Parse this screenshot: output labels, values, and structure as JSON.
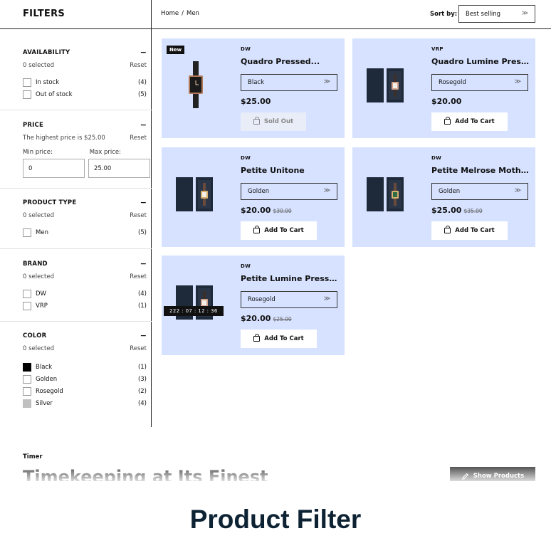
{
  "sidebar": {
    "title": "FILTERS",
    "availability": {
      "title": "AVAILABILITY",
      "selected": "0 selected",
      "reset": "Reset",
      "options": [
        {
          "label": "In stock",
          "count": "(4)"
        },
        {
          "label": "Out of stock",
          "count": "(5)"
        }
      ]
    },
    "price": {
      "title": "PRICE",
      "highest": "The highest price is $25.00",
      "reset": "Reset",
      "min_label": "Min price:",
      "max_label": "Max price:",
      "min_value": "0",
      "max_value": "25.00"
    },
    "product_type": {
      "title": "PRODUCT TYPE",
      "selected": "0 selected",
      "reset": "Reset",
      "options": [
        {
          "label": "Men",
          "count": "(5)"
        }
      ]
    },
    "brand": {
      "title": "BRAND",
      "selected": "0 selected",
      "reset": "Reset",
      "options": [
        {
          "label": "DW",
          "count": "(4)"
        },
        {
          "label": "VRP",
          "count": "(1)"
        }
      ]
    },
    "color": {
      "title": "COLOR",
      "selected": "0 selected",
      "reset": "Reset",
      "options": [
        {
          "label": "Black",
          "count": "(1)",
          "swatch": "#000000"
        },
        {
          "label": "Golden",
          "count": "(3)",
          "swatch": "#ffffff"
        },
        {
          "label": "Rosegold",
          "count": "(2)",
          "swatch": "#ffffff"
        },
        {
          "label": "Silver",
          "count": "(4)",
          "swatch": "#c0c0c0"
        }
      ]
    },
    "minus_symbol": "−"
  },
  "topbar": {
    "breadcrumb": [
      "Home",
      "/",
      "Men"
    ],
    "sort_label": "Sort by:",
    "sort_value": "Best selling",
    "chevron": "≫"
  },
  "products": [
    {
      "badge": "New",
      "brand": "DW",
      "name": "Quadro Pressed...",
      "variant": "Black",
      "price": "$25.00",
      "old_price": "",
      "button": "Sold Out"
    },
    {
      "brand": "VRP",
      "name": "Quadro Lumine Presse...",
      "variant": "Rosegold",
      "price": "$20.00",
      "old_price": "",
      "button": "Add To Cart"
    },
    {
      "brand": "DW",
      "name": "Petite Unitone",
      "variant": "Golden",
      "price": "$20.00",
      "old_price": "$30.00",
      "button": "Add To Cart"
    },
    {
      "brand": "DW",
      "name": "Petite Melrose Mother ...",
      "variant": "Golden",
      "price": "$25.00",
      "old_price": "$35.00",
      "button": "Add To Cart"
    },
    {
      "brand": "DW",
      "name": "Petite Lumine Pressed...",
      "variant": "Rosegold",
      "price": "$20.00",
      "old_price": "$25.00",
      "button": "Add To Cart",
      "timer": "222 : 07 : 12 : 36"
    }
  ],
  "section": {
    "label": "Timer",
    "headline": "Timekeeping at Its Finest",
    "button": "Show Products"
  },
  "caption": "Product Filter",
  "colors": {
    "card_bg": "#d6e2ff",
    "caption": "#0d2233"
  }
}
